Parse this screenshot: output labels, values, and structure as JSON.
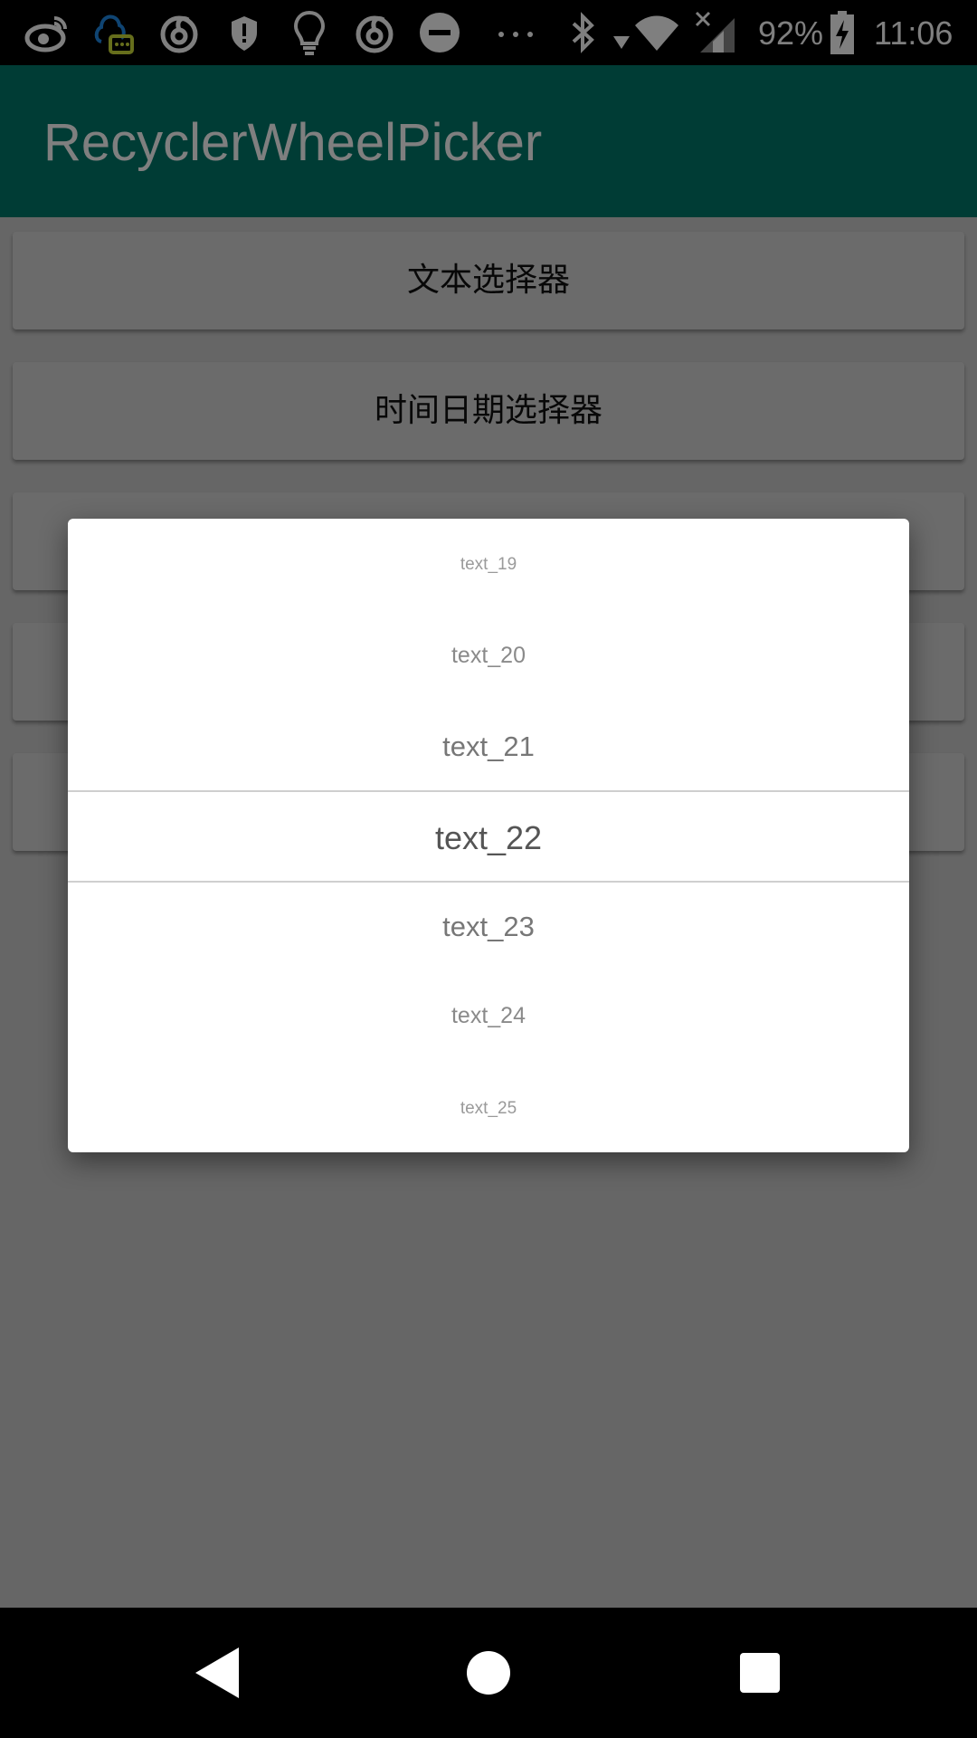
{
  "status_bar": {
    "icons": [
      "weibo-icon",
      "qq-chat-icon",
      "netease-music-icon",
      "shield-alert-icon",
      "lightbulb-icon",
      "netease-music-icon",
      "do-not-disturb-icon",
      "more-dots-icon",
      "bluetooth-icon",
      "wifi-icon",
      "signal-no-sim-icon",
      "battery-charging-icon"
    ],
    "battery": "92%",
    "time": "11:06"
  },
  "app_bar": {
    "title": "RecyclerWheelPicker",
    "color": "#00796b"
  },
  "buttons": [
    {
      "label": "文本选择器"
    },
    {
      "label": "时间日期选择器"
    },
    {
      "label": ""
    },
    {
      "label": ""
    },
    {
      "label": ""
    }
  ],
  "picker_dialog": {
    "items": [
      "text_19",
      "text_20",
      "text_21",
      "text_22",
      "text_23",
      "text_24",
      "text_25"
    ],
    "selected": "text_22"
  },
  "nav_bar": {
    "icons": [
      "back-icon",
      "home-icon",
      "recents-icon"
    ]
  }
}
